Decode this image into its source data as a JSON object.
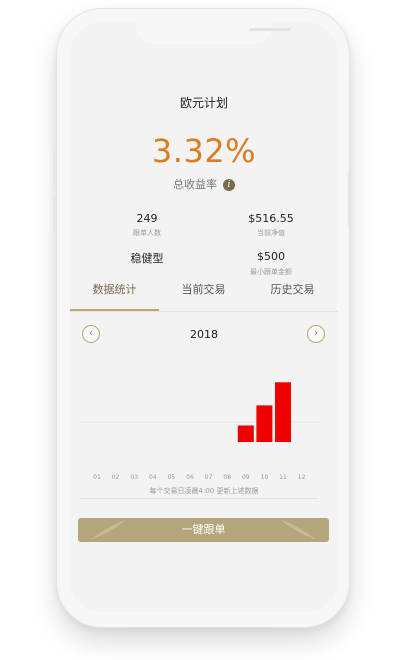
{
  "app": {
    "title": "欧元计划"
  },
  "summary": {
    "return_value": "3.32%",
    "return_label": "总收益率"
  },
  "stats": [
    {
      "value": "249",
      "label": "跟单人数"
    },
    {
      "value": "$516.55",
      "label": "当前净值"
    },
    {
      "value": "稳健型",
      "label": ""
    },
    {
      "value": "$500",
      "label": "最小跟单金额"
    }
  ],
  "tabs": [
    {
      "label": "数据统计",
      "active": true
    },
    {
      "label": "当前交易",
      "active": false
    },
    {
      "label": "历史交易",
      "active": false
    }
  ],
  "chart_nav": {
    "year": "2018",
    "prev_icon": "chevron-left-icon",
    "next_icon": "chevron-right-icon"
  },
  "chart_data": {
    "type": "bar",
    "categories": [
      "01",
      "02",
      "03",
      "04",
      "05",
      "06",
      "07",
      "08",
      "09",
      "10",
      "11",
      "12"
    ],
    "values": [
      0,
      0,
      0,
      0,
      0,
      0,
      0,
      0,
      0.55,
      1.22,
      1.99,
      0
    ],
    "bar_color": "#ee0000"
  },
  "update_note": "每个交易日凌晨4:00 更新上述数据",
  "follow_button": {
    "label": "一键跟单",
    "color": "#b5a57b"
  },
  "colors": {
    "accent": "#e07a1f",
    "gold": "#bda870"
  }
}
